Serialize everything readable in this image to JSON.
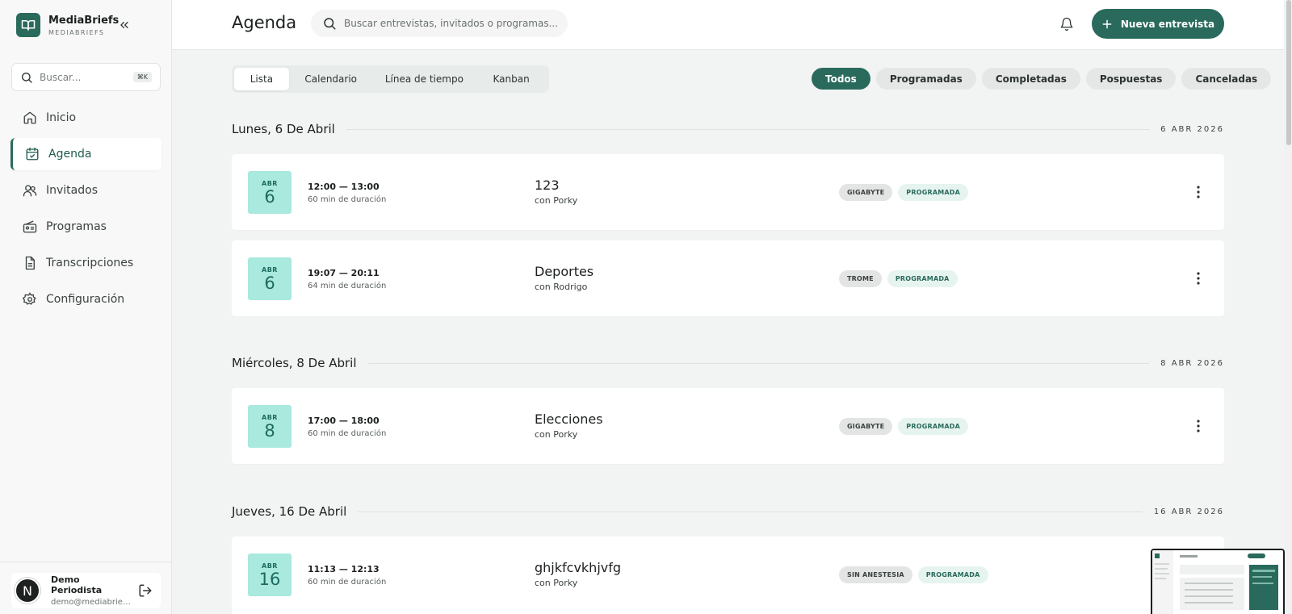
{
  "brand": {
    "name": "MediaBriefs",
    "sub": "MEDIABRIEFS"
  },
  "sidebar": {
    "search_placeholder": "Buscar...",
    "shortcut": "⌘K",
    "items": [
      {
        "label": "Inicio",
        "icon": "home-icon"
      },
      {
        "label": "Agenda",
        "icon": "calendar-icon",
        "active": true
      },
      {
        "label": "Invitados",
        "icon": "users-icon"
      },
      {
        "label": "Programas",
        "icon": "radio-icon"
      },
      {
        "label": "Transcripciones",
        "icon": "document-icon"
      },
      {
        "label": "Configuración",
        "icon": "gear-icon"
      }
    ]
  },
  "user": {
    "initial": "N",
    "name": "Demo Periodista",
    "email": "demo@mediabriefs.com"
  },
  "header": {
    "title": "Agenda",
    "search_placeholder": "Buscar entrevistas, invitados o programas...",
    "new_button": "Nueva entrevista"
  },
  "view_tabs": [
    "Lista",
    "Calendario",
    "Línea de tiempo",
    "Kanban"
  ],
  "filters": [
    "Todos",
    "Programadas",
    "Completadas",
    "Pospuestas",
    "Canceladas"
  ],
  "days": [
    {
      "title": "Lunes, 6 De Abril",
      "date": "6 ABR 2026",
      "items": [
        {
          "month": "ABR",
          "day": "6",
          "time": "12:00 — 13:00",
          "duration": "60 min de duración",
          "title": "123",
          "guest": "con Porky",
          "program": "GIGABYTE",
          "status": "PROGRAMADA"
        },
        {
          "month": "ABR",
          "day": "6",
          "time": "19:07 — 20:11",
          "duration": "64 min de duración",
          "title": "Deportes",
          "guest": "con Rodrigo",
          "program": "TROME",
          "status": "PROGRAMADA"
        }
      ]
    },
    {
      "title": "Miércoles, 8 De Abril",
      "date": "8 ABR 2026",
      "items": [
        {
          "month": "ABR",
          "day": "8",
          "time": "17:00 — 18:00",
          "duration": "60 min de duración",
          "title": "Elecciones",
          "guest": "con Porky",
          "program": "GIGABYTE",
          "status": "PROGRAMADA"
        }
      ]
    },
    {
      "title": "Jueves, 16 De Abril",
      "date": "16 ABR 2026",
      "items": [
        {
          "month": "ABR",
          "day": "16",
          "time": "11:13 — 12:13",
          "duration": "60 min de duración",
          "title": "ghjkfcvkhjvfg",
          "guest": "con Porky",
          "program": "SIN ANESTESIA",
          "status": "PROGRAMADA"
        }
      ]
    }
  ],
  "colors": {
    "accent": "#2a6a5c",
    "badge": "#a9e9de",
    "tag_green_bg": "#e6f4ef"
  }
}
